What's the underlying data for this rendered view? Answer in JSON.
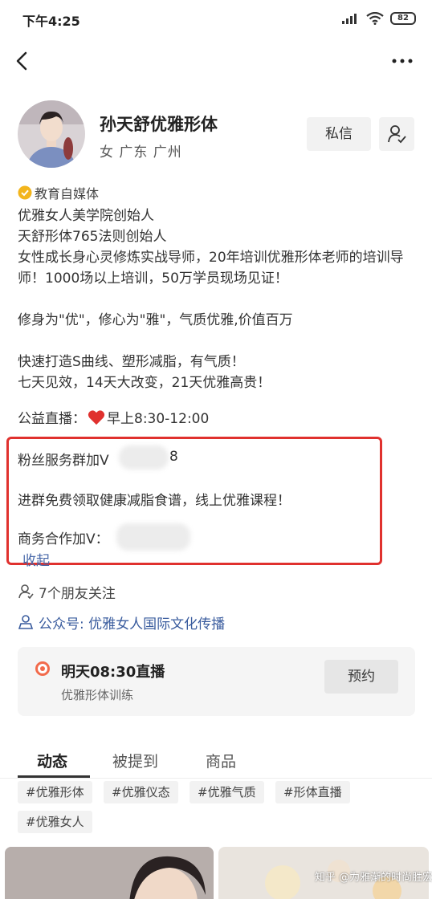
{
  "status_bar": {
    "time": "下午4:25",
    "battery": "82"
  },
  "profile": {
    "name": "孙天舒优雅形体",
    "meta": "女 广东 广州",
    "message_label": "私信",
    "verified_label": "教育自媒体"
  },
  "bio": {
    "line1": "优雅女人美学院创始人",
    "line2": "天舒形体765法则创始人",
    "line3": "女性成长身心灵修炼实战导师，20年培训优雅形体老师的培训导师！1000场以上培训，50万学员现场见证！",
    "line4": "修身为\"优\"，修心为\"雅\"，气质优雅,价值百万",
    "line5": "快速打造S曲线、塑形减脂，有气质！",
    "line6": "七天见效，14天大改变，21天优雅高贵！",
    "live_prefix": "公益直播：",
    "live_time": "早上8:30-12:00",
    "fans_group_prefix": "粉丝服务群加V",
    "fans_group_suffix": "8",
    "free_offer": "进群免费领取健康减脂食谱，线上优雅课程！",
    "business": "商务合作加V："
  },
  "collapse_label": "收起",
  "friends_following": "7个朋友关注",
  "official_account": "公众号: 优雅女人国际文化传播",
  "live_card": {
    "title": "明天08:30直播",
    "subtitle": "优雅形体训练",
    "reserve_label": "预约"
  },
  "tabs": [
    "动态",
    "被提到",
    "商品"
  ],
  "tags": [
    "#优雅形体",
    "#优雅仪态",
    "#优雅气质",
    "#形体直播",
    "#优雅女人"
  ],
  "watermark": "知乎 @为雅渐的时尚胜宏",
  "colors": {
    "accent_red": "#e0312e",
    "link_blue": "#3a5c9e",
    "verified_gold": "#f3b51c",
    "live_orange": "#f26a4b"
  }
}
